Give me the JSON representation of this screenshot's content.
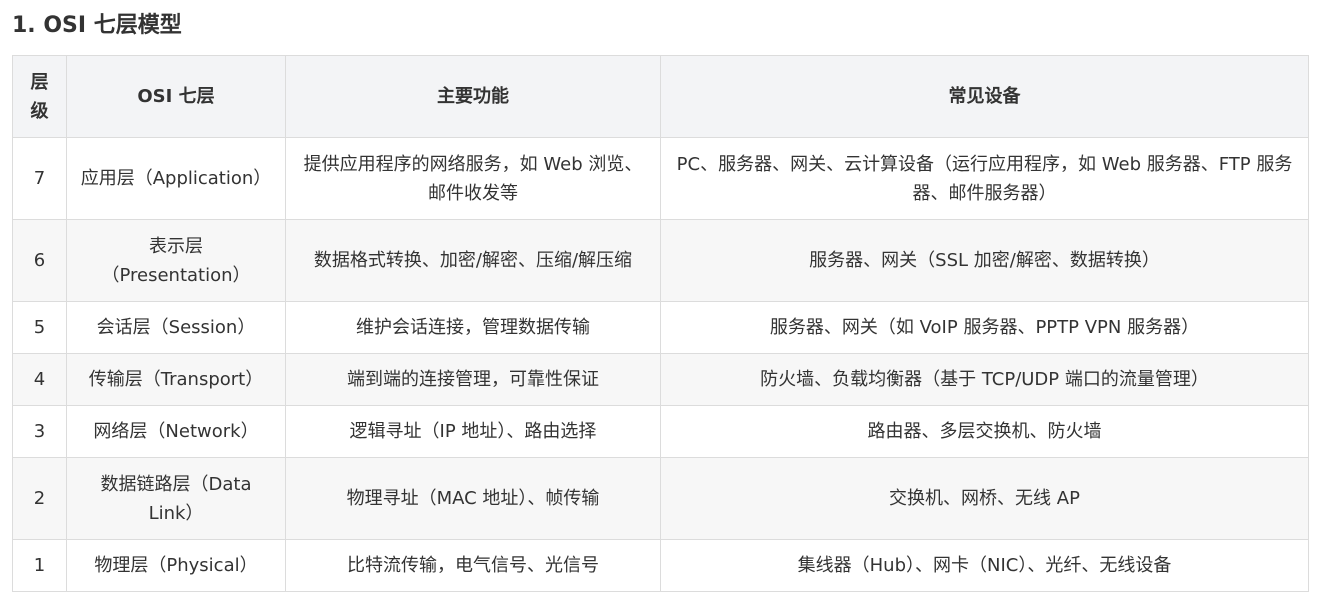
{
  "heading": "1. OSI 七层模型",
  "table": {
    "headers": {
      "level": "层级",
      "layer": "OSI 七层",
      "function": "主要功能",
      "devices": "常见设备"
    },
    "rows": [
      {
        "level": "7",
        "layer": "应用层（Application）",
        "function": "提供应用程序的网络服务，如 Web 浏览、邮件收发等",
        "devices": "PC、服务器、网关、云计算设备（运行应用程序，如 Web 服务器、FTP 服务器、邮件服务器）"
      },
      {
        "level": "6",
        "layer": "表示层（Presentation）",
        "function": "数据格式转换、加密/解密、压缩/解压缩",
        "devices": "服务器、网关（SSL 加密/解密、数据转换）"
      },
      {
        "level": "5",
        "layer": "会话层（Session）",
        "function": "维护会话连接，管理数据传输",
        "devices": "服务器、网关（如 VoIP 服务器、PPTP VPN 服务器）"
      },
      {
        "level": "4",
        "layer": "传输层（Transport）",
        "function": "端到端的连接管理，可靠性保证",
        "devices": "防火墙、负载均衡器（基于 TCP/UDP 端口的流量管理）"
      },
      {
        "level": "3",
        "layer": "网络层（Network）",
        "function": "逻辑寻址（IP 地址）、路由选择",
        "devices": "路由器、多层交换机、防火墙"
      },
      {
        "level": "2",
        "layer": "数据链路层（Data Link）",
        "function": "物理寻址（MAC 地址）、帧传输",
        "devices": "交换机、网桥、无线 AP"
      },
      {
        "level": "1",
        "layer": "物理层（Physical）",
        "function": "比特流传输，电气信号、光信号",
        "devices": "集线器（Hub）、网卡（NIC）、光纤、无线设备"
      }
    ]
  }
}
